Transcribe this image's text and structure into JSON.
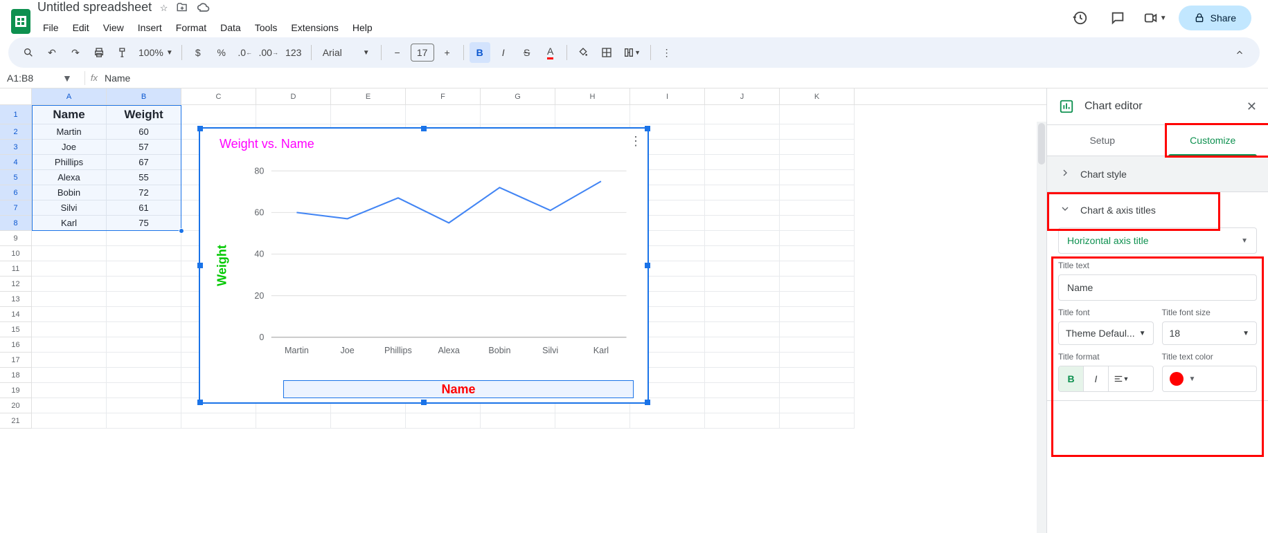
{
  "doc_title": "Untitled spreadsheet",
  "menu": [
    "File",
    "Edit",
    "View",
    "Insert",
    "Format",
    "Data",
    "Tools",
    "Extensions",
    "Help"
  ],
  "share_label": "Share",
  "toolbar": {
    "zoom": "100%",
    "font": "Arial",
    "font_size": "17",
    "increase_decimals_tooltip": "",
    "format_num": "123"
  },
  "name_box": "A1:B8",
  "formula_bar": "Name",
  "columns": [
    "A",
    "B",
    "C",
    "D",
    "E",
    "F",
    "G",
    "H",
    "I",
    "J",
    "K"
  ],
  "rows": [
    "1",
    "2",
    "3",
    "4",
    "5",
    "6",
    "7",
    "8",
    "9",
    "10",
    "11",
    "12",
    "13",
    "14",
    "15",
    "16",
    "17",
    "18",
    "19",
    "20",
    "21"
  ],
  "headers": {
    "A": "Name",
    "B": "Weight"
  },
  "table_data": [
    {
      "A": "Martin",
      "B": "60"
    },
    {
      "A": "Joe",
      "B": "57"
    },
    {
      "A": "Phillips",
      "B": "67"
    },
    {
      "A": "Alexa",
      "B": "55"
    },
    {
      "A": "Bobin",
      "B": "72"
    },
    {
      "A": "Silvi",
      "B": "61"
    },
    {
      "A": "Karl",
      "B": "75"
    }
  ],
  "chart_data": {
    "type": "line",
    "title": "Weight vs. Name",
    "xlabel": "Name",
    "ylabel": "Weight",
    "categories": [
      "Martin",
      "Joe",
      "Phillips",
      "Alexa",
      "Bobin",
      "Silvi",
      "Karl"
    ],
    "values": [
      60,
      57,
      67,
      55,
      72,
      61,
      75
    ],
    "ylim": [
      0,
      80
    ],
    "yticks": [
      0,
      20,
      40,
      60,
      80
    ]
  },
  "chart_editor": {
    "title": "Chart editor",
    "tabs": {
      "setup": "Setup",
      "customize": "Customize"
    },
    "sections": {
      "chart_style": "Chart style",
      "chart_axis_titles": "Chart & axis titles"
    },
    "axis_selector": "Horizontal axis title",
    "title_text_label": "Title text",
    "title_text_value": "Name",
    "title_font_label": "Title font",
    "title_font_value": "Theme Defaul...",
    "title_font_size_label": "Title font size",
    "title_font_size_value": "18",
    "title_format_label": "Title format",
    "title_text_color_label": "Title text color",
    "title_text_color": "#ff0000"
  }
}
